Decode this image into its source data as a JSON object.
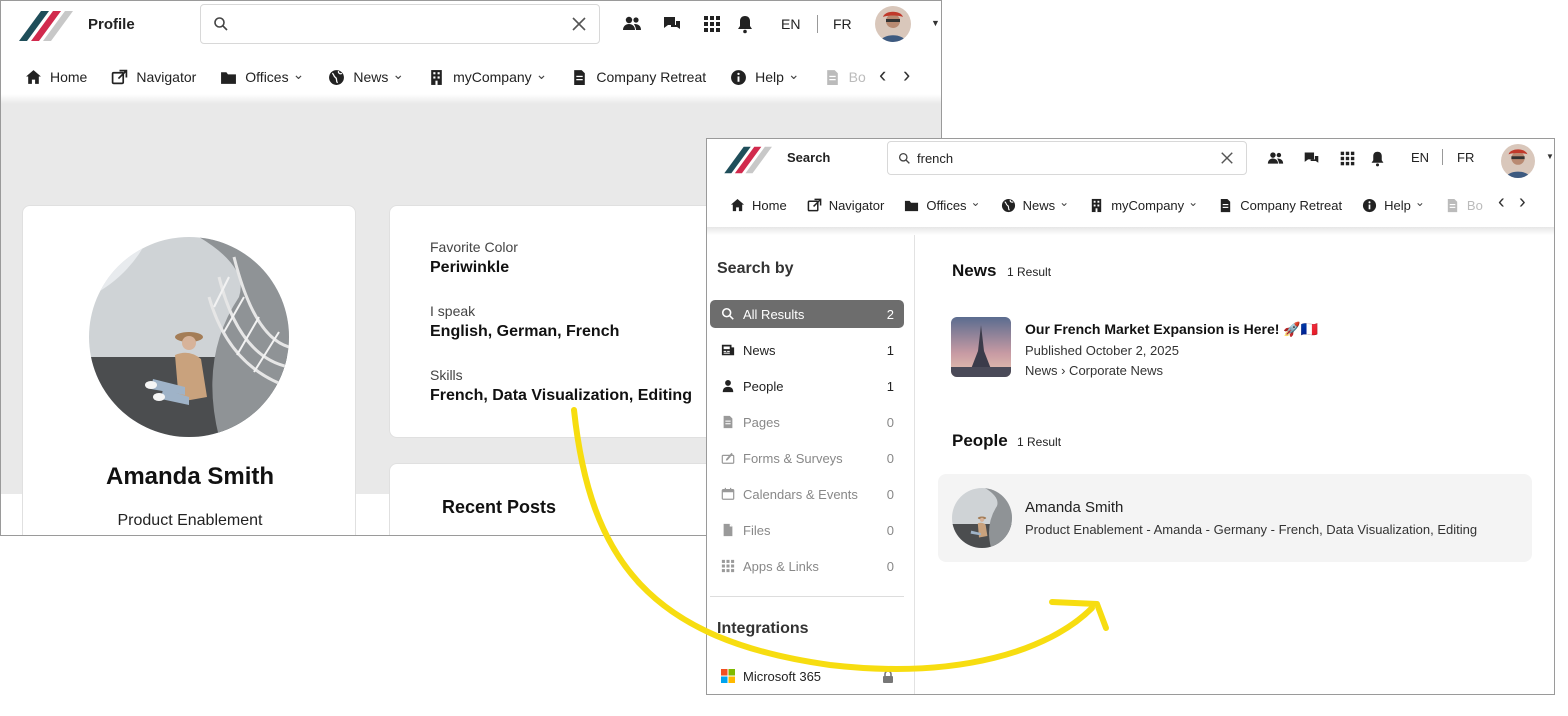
{
  "profile_window": {
    "title": "Profile",
    "search": {
      "value": ""
    },
    "lang": {
      "en": "EN",
      "fr": "FR"
    },
    "nav": [
      {
        "label": "Home",
        "icon": "home-icon",
        "chevron": false
      },
      {
        "label": "Navigator",
        "icon": "external-link-icon",
        "chevron": false
      },
      {
        "label": "Offices",
        "icon": "folder-icon",
        "chevron": true
      },
      {
        "label": "News",
        "icon": "globe-icon",
        "chevron": true
      },
      {
        "label": "myCompany",
        "icon": "building-icon",
        "chevron": true
      },
      {
        "label": "Company Retreat",
        "icon": "document-icon",
        "chevron": false
      },
      {
        "label": "Help",
        "icon": "info-icon",
        "chevron": true
      },
      {
        "label": "Bo",
        "icon": "document-icon",
        "chevron": false
      }
    ],
    "fields": {
      "favorite_color_label": "Favorite Color",
      "favorite_color_value": "Periwinkle",
      "speak_label": "I speak",
      "speak_value": "English, German, French",
      "skills_label": "Skills",
      "skills_value": "French, Data Visualization, Editing"
    },
    "user_name": "Amanda Smith",
    "user_role": "Product Enablement",
    "recent_posts_title": "Recent Posts"
  },
  "search_window": {
    "title": "Search",
    "search": {
      "value": "french"
    },
    "lang": {
      "en": "EN",
      "fr": "FR"
    },
    "nav": [
      {
        "label": "Home",
        "icon": "home-icon",
        "chevron": false
      },
      {
        "label": "Navigator",
        "icon": "external-link-icon",
        "chevron": false
      },
      {
        "label": "Offices",
        "icon": "folder-icon",
        "chevron": true
      },
      {
        "label": "News",
        "icon": "globe-icon",
        "chevron": true
      },
      {
        "label": "myCompany",
        "icon": "building-icon",
        "chevron": true
      },
      {
        "label": "Company Retreat",
        "icon": "document-icon",
        "chevron": false
      },
      {
        "label": "Help",
        "icon": "info-icon",
        "chevron": true
      },
      {
        "label": "Bo",
        "icon": "document-icon",
        "chevron": false
      }
    ],
    "search_by": "Search by",
    "categories": [
      {
        "label": "All Results",
        "count": "2",
        "icon": "search-icon",
        "active": true,
        "enabled": true
      },
      {
        "label": "News",
        "count": "1",
        "icon": "newspaper-icon",
        "active": false,
        "enabled": true
      },
      {
        "label": "People",
        "count": "1",
        "icon": "person-icon",
        "active": false,
        "enabled": true
      },
      {
        "label": "Pages",
        "count": "0",
        "icon": "page-icon",
        "active": false,
        "enabled": false
      },
      {
        "label": "Forms & Surveys",
        "count": "0",
        "icon": "form-icon",
        "active": false,
        "enabled": false
      },
      {
        "label": "Calendars & Events",
        "count": "0",
        "icon": "calendar-icon",
        "active": false,
        "enabled": false
      },
      {
        "label": "Files",
        "count": "0",
        "icon": "file-icon",
        "active": false,
        "enabled": false
      },
      {
        "label": "Apps & Links",
        "count": "0",
        "icon": "apps-grid-icon",
        "active": false,
        "enabled": false
      }
    ],
    "integrations_title": "Integrations",
    "integration_item": "Microsoft 365",
    "news_section": {
      "title": "News",
      "count": "1 Result"
    },
    "news_result": {
      "title": "Our French Market Expansion is Here! 🚀🇫🇷",
      "published": "Published October 2, 2025",
      "path": "News › Corporate News"
    },
    "people_section": {
      "title": "People",
      "count": "1 Result"
    },
    "people_result": {
      "name": "Amanda Smith",
      "details": "Product Enablement - Amanda - Germany - French, Data Visualization, Editing"
    }
  },
  "colors": {
    "arrow": "#f7dd10",
    "active_bg": "#6d6d6d",
    "logo_dark": "#1f4e5a",
    "logo_red": "#d12a4d"
  }
}
